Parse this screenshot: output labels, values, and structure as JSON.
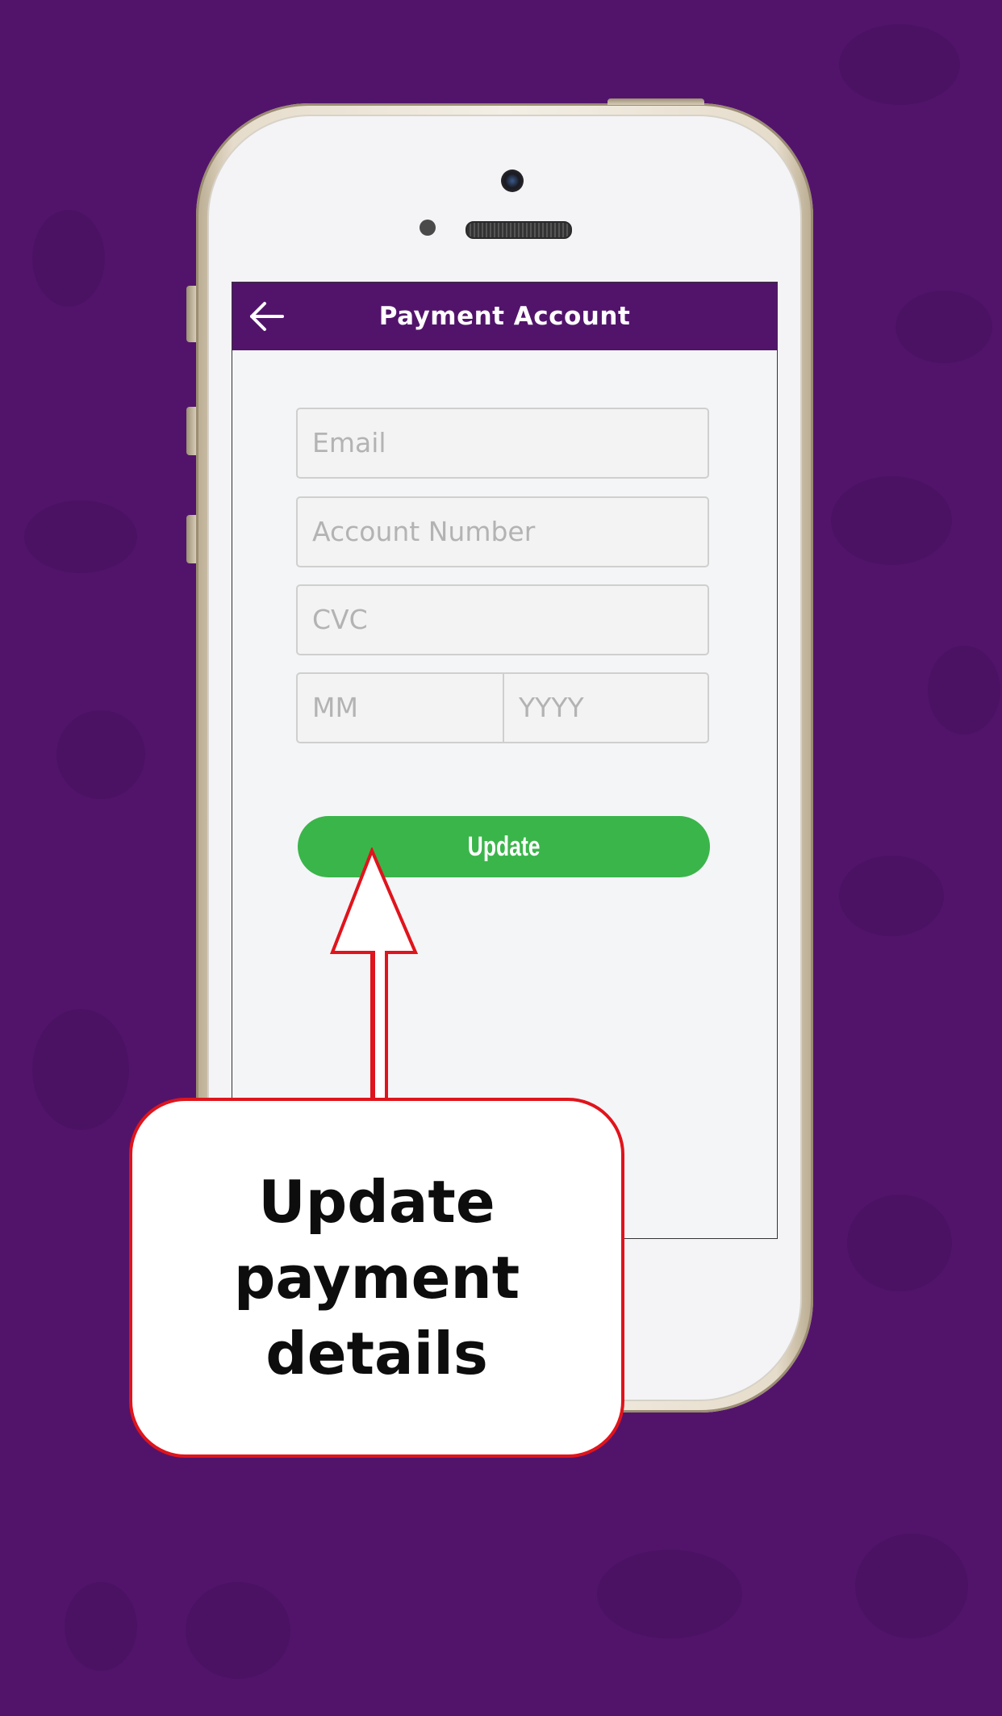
{
  "app_bar": {
    "title": "Payment Account",
    "back_icon": "arrow-left-icon"
  },
  "form": {
    "email_placeholder": "Email",
    "account_number_placeholder": "Account Number",
    "cvc_placeholder": "CVC",
    "month_placeholder": "MM",
    "year_placeholder": "YYYY",
    "update_label": "Update"
  },
  "callout": {
    "text": "Update payment details"
  },
  "colors": {
    "background": "#52146b",
    "app_bar": "#52146b",
    "update_button": "#3ab54a",
    "callout_border": "#e0141c"
  }
}
